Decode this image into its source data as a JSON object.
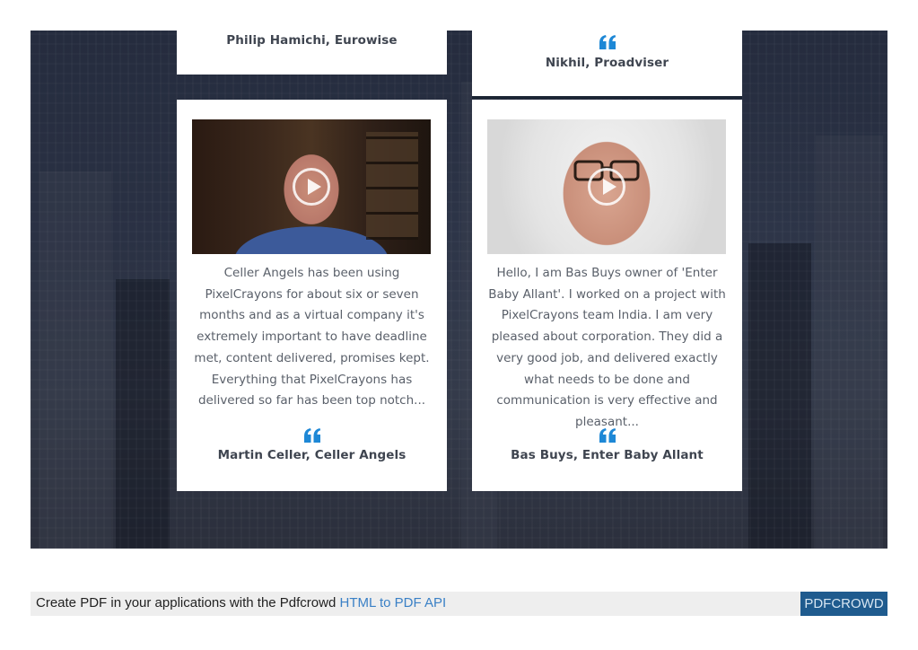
{
  "testimonials": {
    "top_left": {
      "author": "Philip Hamichi, Eurowise"
    },
    "top_right": {
      "author": "Nikhil, Proadviser"
    },
    "bottom_left": {
      "text": "Celler Angels has been using PixelCrayons for about six or seven months and as a virtual company it's extremely important to have deadline met, content delivered, promises kept. Everything that PixelCrayons has delivered so far has been top notch...",
      "author": "Martin Celler, Celler Angels"
    },
    "bottom_right": {
      "text": "Hello, I am Bas Buys owner of 'Enter Baby Allant'. I worked on a project with PixelCrayons team India. I am very pleased about corporation. They did a very good job, and delivered exactly what needs to be done and communication is very effective and pleasant...",
      "author": "Bas Buys, Enter Baby Allant"
    }
  },
  "icons": {
    "quote": "quote-icon",
    "play": "play-icon"
  },
  "colors": {
    "accent": "#1e88d6",
    "dark_border": "#1b2533",
    "pdf_button": "#1f5b8e",
    "link": "#3a80c6"
  },
  "footer": {
    "text": "Create PDF in your applications with the Pdfcrowd ",
    "link_text": "HTML to PDF API",
    "button_label": "PDFCROWD"
  }
}
